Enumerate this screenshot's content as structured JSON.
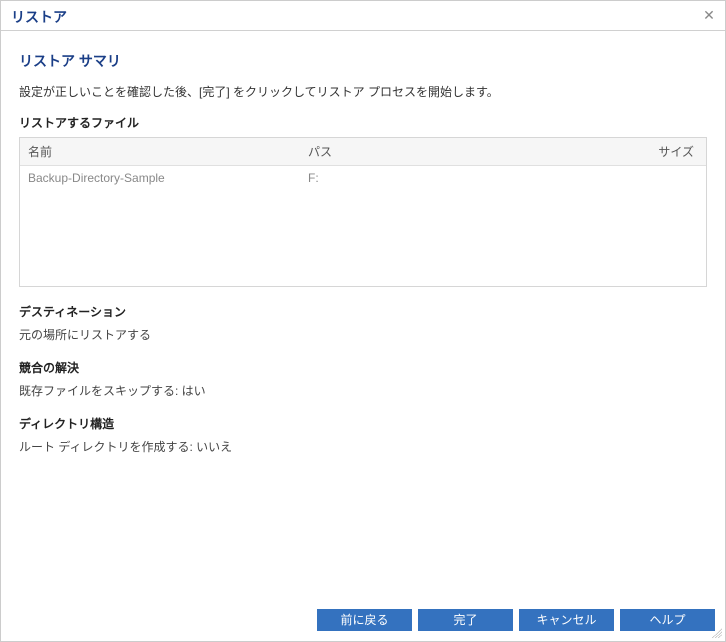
{
  "window": {
    "title": "リストア"
  },
  "summary": {
    "title": "リストア サマリ",
    "description": "設定が正しいことを確認した後、[完了] をクリックしてリストア プロセスを開始します。"
  },
  "filesSection": {
    "heading": "リストアするファイル",
    "columns": {
      "name": "名前",
      "path": "パス",
      "size": "サイズ"
    },
    "rows": [
      {
        "name": "Backup-Directory-Sample",
        "path": "F:",
        "size": ""
      }
    ]
  },
  "destination": {
    "heading": "デスティネーション",
    "value": "元の場所にリストアする"
  },
  "conflict": {
    "heading": "競合の解決",
    "value": "既存ファイルをスキップする: はい"
  },
  "dirStructure": {
    "heading": "ディレクトリ構造",
    "value": "ルート ディレクトリを作成する: いいえ"
  },
  "buttons": {
    "back": "前に戻る",
    "finish": "完了",
    "cancel": "キャンセル",
    "help": "ヘルプ"
  }
}
